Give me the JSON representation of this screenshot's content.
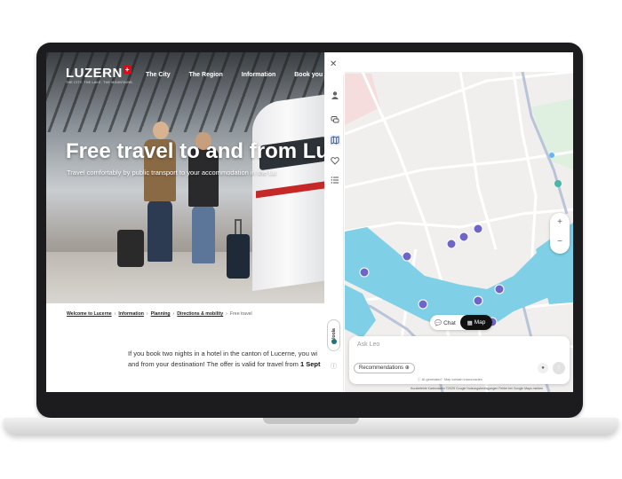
{
  "site": {
    "logo_text": "LUZERN",
    "logo_cross": "+",
    "logo_tagline": "THE CITY. THE LAKE. THE MOUNTAINS.",
    "nav": [
      "The City",
      "The Region",
      "Information",
      "Book you"
    ],
    "hero_title": "Free travel to and from Lu",
    "hero_subtitle": "Travel comfortably by public transport to your accommodation in the Lu",
    "breadcrumb": [
      "Welcome to Lucerne",
      "Information",
      "Planning",
      "Directions & mobility"
    ],
    "breadcrumb_current": "Free travel",
    "body_line1": "If you book two nights in a hotel in the canton of Lucerne, you wi",
    "body_line2_prefix": "and from your destination! The offer is valid for travel from ",
    "body_line2_bold": "1 Sept"
  },
  "assistant": {
    "close_icon": "close-icon",
    "rail_icons": [
      "avatar-icon",
      "chat-bubbles-icon",
      "map-icon",
      "heart-icon",
      "list-icon"
    ],
    "active_rail": "map-icon",
    "powered_by": "loola",
    "toggle_chat": "Chat",
    "toggle_map": "Map",
    "input_placeholder": "Ask Leo",
    "recommendations_label": "Recommendations",
    "ai_note": "AI-generated · May contain inaccuracies",
    "map_attribution": "Kurzbefehle   Kartendaten ©2025 Google   Nutzungsbedingungen   Fehler bei Google Maps melden",
    "colors": {
      "water": "#7fd0e6",
      "pin": "#6f64c9",
      "road": "#ffffff",
      "land": "#f0efed"
    }
  }
}
